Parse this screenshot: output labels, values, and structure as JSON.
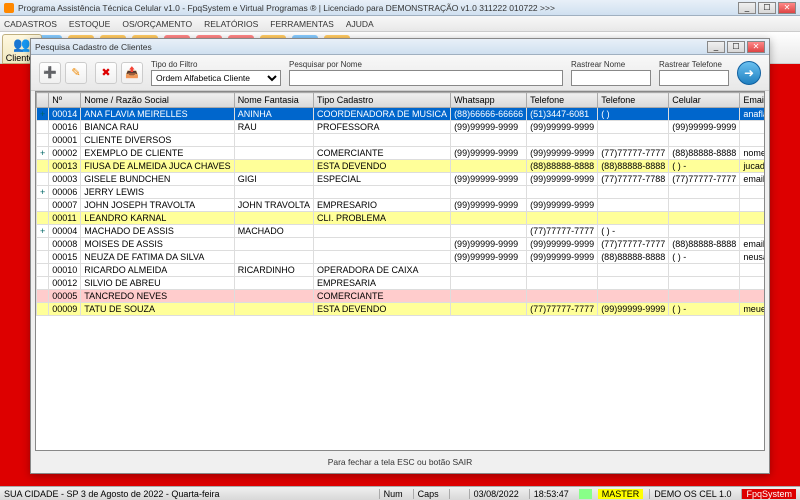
{
  "title": "Programa Assistência Técnica Celular v1.0 - FpqSystem e Virtual Programas ® | Licenciado para  DEMONSTRAÇÃO v1.0 311222 010722 >>>",
  "menu": [
    "CADASTROS",
    "ESTOQUE",
    "OS/ORÇAMENTO",
    "RELATÓRIOS",
    "FERRAMENTAS",
    "AJUDA"
  ],
  "clientes_tab": "Clientes",
  "modal": {
    "title": "Pesquisa Cadastro de Clientes",
    "filter_type_label": "Tipo do Filtro",
    "filter_type_value": "Ordem Alfabetica Cliente",
    "search_name_label": "Pesquisar por Nome",
    "track_name_label": "Rastrear Nome",
    "track_phone_label": "Rastrear Telefone",
    "footer": "Para fechar a tela ESC ou botão SAIR"
  },
  "cols": [
    "",
    "Nº",
    "Nome / Razão Social",
    "Nome Fantasia",
    "Tipo Cadastro",
    "Whatsapp",
    "Telefone",
    "Telefone",
    "Celular",
    "Email >>>"
  ],
  "rows": [
    {
      "cls": "sel",
      "exp": "+",
      "n": "00014",
      "nome": "ANA FLAVIA MEIRELLES",
      "fant": "ANINHA",
      "tipo": "COORDENADORA DE MUSICA",
      "wa": "(88)66666-66666",
      "t1": "(51)3447-6081",
      "t2": "( )",
      "cel": "",
      "em": "anaflavia@anaflavia.com.br"
    },
    {
      "cls": "",
      "exp": "",
      "n": "00016",
      "nome": "BIANCA RAU",
      "fant": "RAU",
      "tipo": "PROFESSORA",
      "wa": "(99)99999-9999",
      "t1": "(99)99999-9999",
      "t2": "",
      "cel": "(99)99999-9999",
      "em": ""
    },
    {
      "cls": "",
      "exp": "",
      "n": "00001",
      "nome": "CLIENTE DIVERSOS",
      "fant": "",
      "tipo": "",
      "wa": "",
      "t1": "",
      "t2": "",
      "cel": "",
      "em": ""
    },
    {
      "cls": "",
      "exp": "+",
      "n": "00002",
      "nome": "EXEMPLO DE CLIENTE",
      "fant": "",
      "tipo": "COMERCIANTE",
      "wa": "(99)99999-9999",
      "t1": "(99)99999-9999",
      "t2": "(77)77777-7777",
      "cel": "(88)88888-8888",
      "em": "nomedoemail@email.com.br"
    },
    {
      "cls": "yellow",
      "exp": "",
      "n": "00013",
      "nome": "FIUSA DE ALMEIDA JUCA CHAVES",
      "fant": "",
      "tipo": "ESTA DEVENDO",
      "wa": "",
      "t1": "(88)88888-8888",
      "t2": "(88)88888-8888",
      "cel": "( )  -",
      "em": "jucadealmeida@jucadealmeida.com.b"
    },
    {
      "cls": "",
      "exp": "",
      "n": "00003",
      "nome": "GISELE BUNDCHEN",
      "fant": "GIGI",
      "tipo": "ESPECIAL",
      "wa": "(99)99999-9999",
      "t1": "(99)99999-9999",
      "t2": "(77)77777-7788",
      "cel": "(77)77777-7777",
      "em": "emaildagigi@gigi.com.br"
    },
    {
      "cls": "",
      "exp": "+",
      "n": "00006",
      "nome": "JERRY LEWIS",
      "fant": "",
      "tipo": "",
      "wa": "",
      "t1": "",
      "t2": "",
      "cel": "",
      "em": ""
    },
    {
      "cls": "",
      "exp": "",
      "n": "00007",
      "nome": "JOHN JOSEPH TRAVOLTA",
      "fant": "JOHN TRAVOLTA",
      "tipo": "EMPRESARIO",
      "wa": "(99)99999-9999",
      "t1": "(99)99999-9999",
      "t2": "",
      "cel": "",
      "em": ""
    },
    {
      "cls": "yellow",
      "exp": "",
      "n": "00011",
      "nome": "LEANDRO KARNAL",
      "fant": "",
      "tipo": "CLI. PROBLEMA",
      "wa": "",
      "t1": "",
      "t2": "",
      "cel": "",
      "em": ""
    },
    {
      "cls": "",
      "exp": "+",
      "n": "00004",
      "nome": "MACHADO DE ASSIS",
      "fant": "MACHADO",
      "tipo": "",
      "wa": "",
      "t1": "(77)77777-7777",
      "t2": "( )  -",
      "cel": "",
      "em": ""
    },
    {
      "cls": "",
      "exp": "",
      "n": "00008",
      "nome": "MOISES DE ASSIS",
      "fant": "",
      "tipo": "",
      "wa": "(99)99999-9999",
      "t1": "(99)99999-9999",
      "t2": "(77)77777-7777",
      "cel": "(88)88888-8888",
      "em": "emaildemoises@moises.com.br"
    },
    {
      "cls": "",
      "exp": "",
      "n": "00015",
      "nome": "NEUZA DE FATIMA DA SILVA",
      "fant": "",
      "tipo": "",
      "wa": "(99)99999-9999",
      "t1": "(99)99999-9999",
      "t2": "(88)88888-8888",
      "cel": "( )  -",
      "em": "neusadefatima@fatima.com.br"
    },
    {
      "cls": "",
      "exp": "",
      "n": "00010",
      "nome": "RICARDO ALMEIDA",
      "fant": "RICARDINHO",
      "tipo": "OPERADORA DE CAIXA",
      "wa": "",
      "t1": "",
      "t2": "",
      "cel": "",
      "em": ""
    },
    {
      "cls": "",
      "exp": "",
      "n": "00012",
      "nome": "SILVIO DE ABREU",
      "fant": "",
      "tipo": "EMPRESARIA",
      "wa": "",
      "t1": "",
      "t2": "",
      "cel": "",
      "em": ""
    },
    {
      "cls": "pink",
      "exp": "",
      "n": "00005",
      "nome": "TANCREDO NEVES",
      "fant": "",
      "tipo": "COMERCIANTE",
      "wa": "",
      "t1": "",
      "t2": "",
      "cel": "",
      "em": ""
    },
    {
      "cls": "yellow",
      "exp": "",
      "n": "00009",
      "nome": "TATU DE SOUZA",
      "fant": "",
      "tipo": "ESTA DEVENDO",
      "wa": "",
      "t1": "(77)77777-7777",
      "t2": "(99)99999-9999",
      "cel": "( )  -",
      "em": "meuemail@email.com.b"
    }
  ],
  "status": {
    "loc": "SUA CIDADE - SP  3 de Agosto de 2022 - Quarta-feira",
    "num": "Num",
    "caps": "Caps",
    "date": "03/08/2022",
    "time": "18:53:47",
    "master": "MASTER",
    "demo": "DEMO OS CEL 1.0",
    "brand": "FpqSystem"
  }
}
